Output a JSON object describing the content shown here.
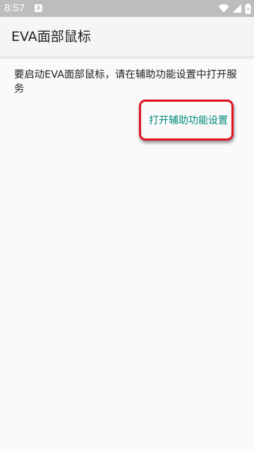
{
  "status_bar": {
    "time": "8:57",
    "notification_badge": "A",
    "icons": [
      "wifi-icon",
      "signal-icon",
      "battery-icon"
    ]
  },
  "app_bar": {
    "title": "EVA面部鼠标"
  },
  "content": {
    "message": "要启动EVA面部鼠标，请在辅助功能设置中打开服务",
    "button_label": "打开辅助功能设置"
  },
  "colors": {
    "status_bar_bg": "#bdbdbd",
    "app_bar_bg": "#f5f5f5",
    "page_bg": "#fafafa",
    "accent_text": "#00897b",
    "highlight_border": "#e0121f",
    "primary_text": "#212121"
  }
}
